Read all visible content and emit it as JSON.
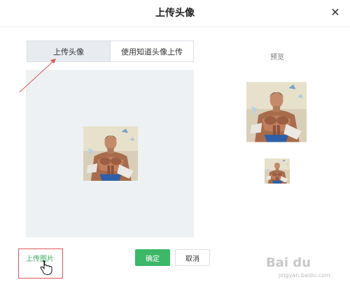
{
  "dialog": {
    "title": "上传头像"
  },
  "tabs": [
    {
      "label": "上传头像",
      "active": true
    },
    {
      "label": "使用知道头像上传",
      "active": false
    }
  ],
  "preview": {
    "label": "预览"
  },
  "upload": {
    "label": "上传图片"
  },
  "actions": {
    "confirm_label": "确定",
    "cancel_label": "取消"
  },
  "icons": {
    "close": "close-icon",
    "cursor": "hand-cursor-icon"
  },
  "watermark": {
    "text": "Bai du",
    "sub": "jingyan.baidu.com"
  },
  "colors": {
    "accent": "#3db768",
    "highlight_box": "#e05555",
    "upload_text": "#3aa85f",
    "editor_bg": "#eef1f4",
    "tab_active_bg": "#e8ebf0"
  }
}
